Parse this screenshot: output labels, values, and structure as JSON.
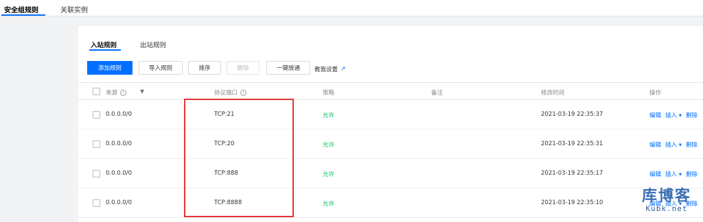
{
  "top_tabs": [
    "安全组规则",
    "关联实例"
  ],
  "sub_tabs": [
    "入站规则",
    "出站规则"
  ],
  "toolbar": {
    "add": "添加规则",
    "import": "导入规则",
    "sort": "排序",
    "delete": "删除",
    "one_click": "一键放通",
    "tutorial": "教我设置"
  },
  "columns": {
    "source": "来源",
    "protocol_port": "协议端口",
    "policy": "策略",
    "note": "备注",
    "modified": "修改时间",
    "actions": "操作"
  },
  "rows": [
    {
      "source": "0.0.0.0/0",
      "port": "TCP:21",
      "policy": "允许",
      "note": "",
      "modified": "2021-03-19 22:35:37"
    },
    {
      "source": "0.0.0.0/0",
      "port": "TCP:20",
      "policy": "允许",
      "note": "",
      "modified": "2021-03-19 22:35:31"
    },
    {
      "source": "0.0.0.0/0",
      "port": "TCP:888",
      "policy": "允许",
      "note": "",
      "modified": "2021-03-19 22:35:17"
    },
    {
      "source": "0.0.0.0/0",
      "port": "TCP:8888",
      "policy": "允许",
      "note": "",
      "modified": "2021-03-19 22:35:10"
    }
  ],
  "row_actions": {
    "edit": "编辑",
    "insert": "插入",
    "delete": "删除"
  },
  "watermark": {
    "main": "库博客",
    "sub": "Kubk.net"
  },
  "colors": {
    "primary": "#006eff",
    "allow": "#0abf5b",
    "highlight": "#e53333"
  }
}
